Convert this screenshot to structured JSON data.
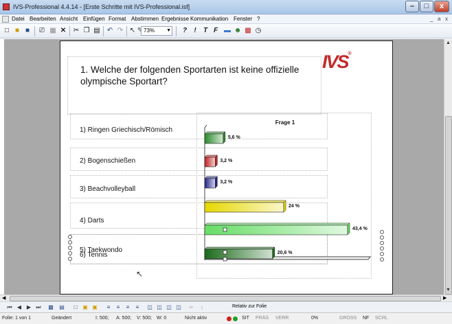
{
  "window": {
    "title": "IVS-Professional 4.4.14 - [Erste Schritte mit IVS-Professional.isf]",
    "minimize": "–",
    "maximize": "□",
    "close": "x"
  },
  "menu": {
    "items": [
      "Datei",
      "Bearbeiten",
      "Ansicht",
      "Einfügen",
      "Format",
      "Abstimmen",
      "Ergebnisse",
      "Kommunikation",
      "Fenster",
      "?"
    ],
    "mdi_controls": [
      "_",
      "a",
      "x"
    ]
  },
  "toolbar": {
    "zoom": "73%",
    "text_buttons": [
      "?",
      "!",
      "T",
      "F"
    ]
  },
  "slide": {
    "question": "1. Welche der folgenden Sportarten ist keine offizielle olympische Sportart?",
    "logo": "IVS",
    "logo_mark": "®",
    "answers": [
      "1) Ringen Griechisch/Römisch",
      "2) Bogenschießen",
      "3) Beachvolleyball",
      "4) Darts",
      "5) Taekwondo",
      "6) Tennis"
    ]
  },
  "chart_data": {
    "type": "bar",
    "orientation": "horizontal",
    "title": "Frage 1",
    "categories": [
      "1",
      "2",
      "3",
      "4",
      "5",
      "6"
    ],
    "values": [
      5.6,
      3.2,
      3.2,
      24,
      43.4,
      20.6
    ],
    "value_labels": [
      "5,6 %",
      "3,2 %",
      "3,2 %",
      "24 %",
      "43,4 %",
      "20,6 %"
    ],
    "colors": [
      "#2a8a2a",
      "#c02020",
      "#24248a",
      "#e6d800",
      "#66dd66",
      "#1a6a1a"
    ],
    "xlim": [
      0,
      43.4
    ]
  },
  "navbar": {
    "relative_label": "Relativ zur Folie"
  },
  "status": {
    "slide": "Folie: 1 von 1",
    "changed": "Geändert",
    "s1": "I: 500;",
    "s2": "A: 500;",
    "s3": "V: 500;",
    "s4": "W: 0",
    "active": "Nicht aktiv",
    "sit": "SIT",
    "pras": "PRÄS",
    "verr": "VERR",
    "pct": "0%",
    "gross": "GROSS",
    "nf": "NF",
    "scrl": "SCRL"
  }
}
